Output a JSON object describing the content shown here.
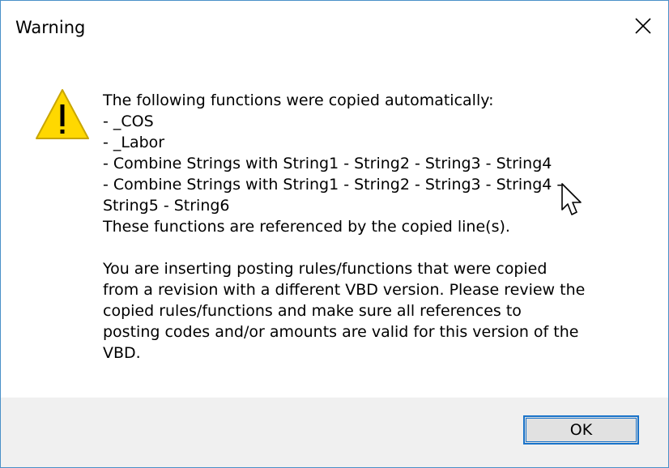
{
  "window": {
    "title": "Warning"
  },
  "icons": {
    "close": "close-icon",
    "warning": "warning-icon",
    "cursor": "mouse-pointer-icon"
  },
  "message": {
    "lines": [
      "The following functions were copied automatically:",
      "- _COS",
      "- _Labor",
      "- Combine Strings with String1 - String2 - String3 - String4",
      "- Combine Strings with String1 - String2 - String3 - String4 -",
      "String5 - String6",
      "These functions are referenced by the copied line(s).",
      "",
      "You are inserting posting rules/functions that were copied",
      "from a revision with a different VBD version. Please review the",
      "copied rules/functions and make sure all references to",
      "posting codes and/or amounts are valid for this version of the",
      "VBD."
    ]
  },
  "buttons": {
    "ok_label": "OK"
  },
  "colors": {
    "border": "#4a90c8",
    "footer_bg": "#f0f0f0",
    "button_focus": "#1a73c9",
    "warning_yellow": "#ffd800"
  }
}
